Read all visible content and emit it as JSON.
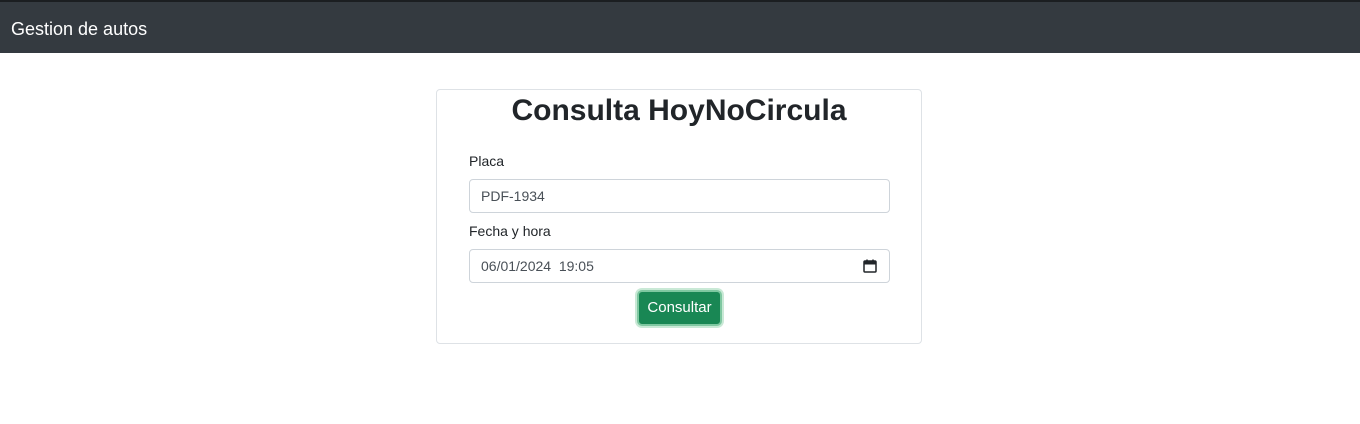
{
  "navbar": {
    "brand": "Gestion de autos"
  },
  "form": {
    "title": "Consulta HoyNoCircula",
    "plate_label": "Placa",
    "plate_value": "PDF-1934",
    "datetime_label": "Fecha y hora",
    "datetime_value": "06/01/2024  19:05",
    "submit_label": "Consultar"
  },
  "icons": {
    "datetime_picker": "calendar-icon"
  },
  "colors": {
    "navbar_bg": "#343a40",
    "button_bg": "#198754"
  }
}
